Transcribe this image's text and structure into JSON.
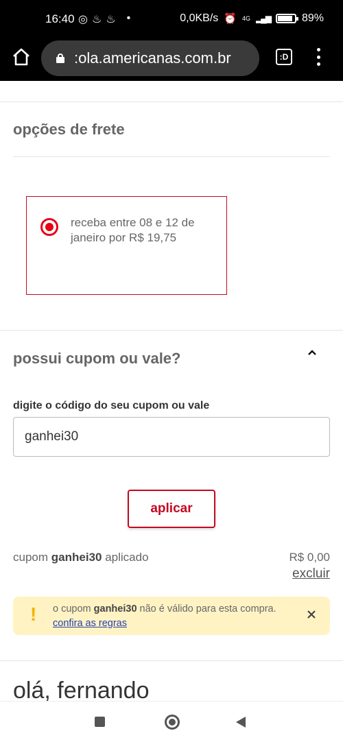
{
  "status_bar": {
    "time": "16:40",
    "network_speed": "0,0KB/s",
    "network_type": "4G",
    "battery_percent": "89%",
    "battery_level": 0.89
  },
  "browser": {
    "url": ":ola.americanas.com.br",
    "tabs_label": ":D"
  },
  "shipping": {
    "title": "opções de frete",
    "option_text": "receba entre 08 e 12 de janeiro por R$ 19,75",
    "accent": "#e60014"
  },
  "coupon": {
    "title": "possui cupom ou vale?",
    "field_label": "digite o código do seu cupom ou vale",
    "input_value": "ganhei30",
    "apply_label": "aplicar",
    "status_prefix": "cupom",
    "status_code": "ganhei30",
    "status_suffix": "aplicado",
    "discount_value": "R$ 0,00",
    "remove_label": "excluir"
  },
  "warning": {
    "text_prefix": "o cupom",
    "code": "ganhei30",
    "text_suffix": "não é válido para esta compra.",
    "link_label": "confira as regras",
    "color": "#fff3c4"
  },
  "greeting": "olá, fernando",
  "brand_color": "#c4081f"
}
